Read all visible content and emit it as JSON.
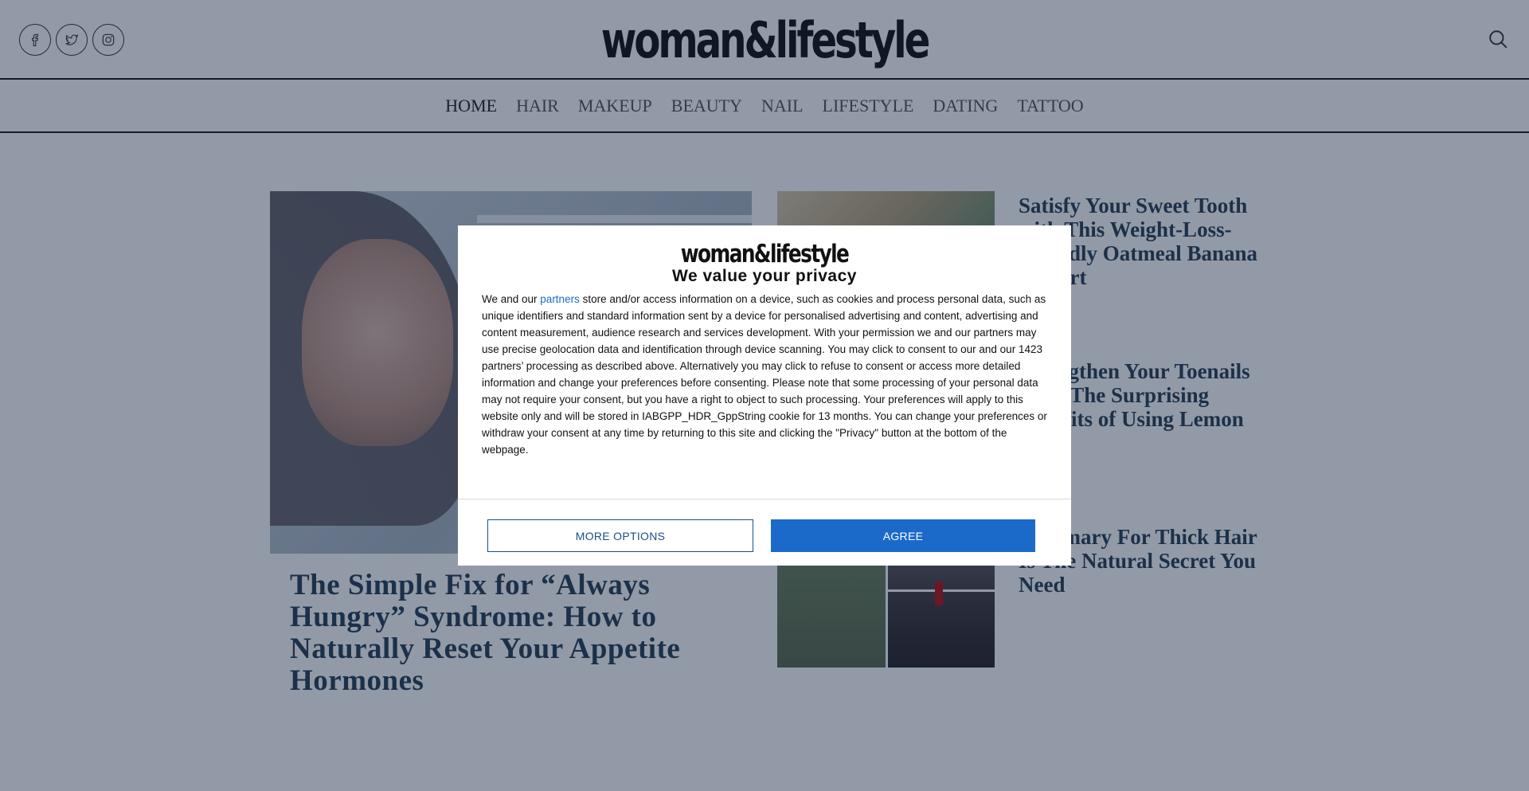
{
  "site": {
    "logo": "woman&lifestyle"
  },
  "social": [
    "facebook-icon",
    "twitter-icon",
    "instagram-icon"
  ],
  "nav": {
    "items": [
      "HOME",
      "HAIR",
      "MAKEUP",
      "BEAUTY",
      "NAIL",
      "LIFESTYLE",
      "DATING",
      "TATTOO"
    ],
    "active": "HOME"
  },
  "main": {
    "hero_title": "The Simple Fix for “Always Hungry” Syndrome: How to Naturally Reset Your Appetite Hormones",
    "articles": [
      {
        "title": "Satisfy Your Sweet Tooth with This Weight-Loss-Friendly Oatmeal Banana Dessert"
      },
      {
        "title": "Strengthen Your Toenails With The Surprising Benefits of Using Lemon Juice"
      },
      {
        "title": "Rosemary For Thick Hair Is The Natural Secret You Need"
      }
    ]
  },
  "consent": {
    "logo": "woman&lifestyle",
    "title": "We value your privacy",
    "body_prefix": "We and our ",
    "body_link": "partners",
    "body_rest": " store and/or access information on a device, such as cookies and process personal data, such as unique identifiers and standard information sent by a device for personalised advertising and content, advertising and content measurement, audience research and services development. With your permission we and our partners may use precise geolocation data and identification through device scanning. You may click to consent to our and our 1423 partners’ processing as described above. Alternatively you may click to refuse to consent or access more detailed information and change your preferences before consenting. Please note that some processing of your personal data may not require your consent, but you have a right to object to such processing. Your preferences will apply to this website only and will be stored in IABGPP_HDR_GppString cookie for 13 months. You can change your preferences or withdraw your consent at any time by returning to this site and clicking the \"Privacy\" button at the bottom of the webpage.",
    "more_options": "MORE OPTIONS",
    "agree": "AGREE"
  }
}
